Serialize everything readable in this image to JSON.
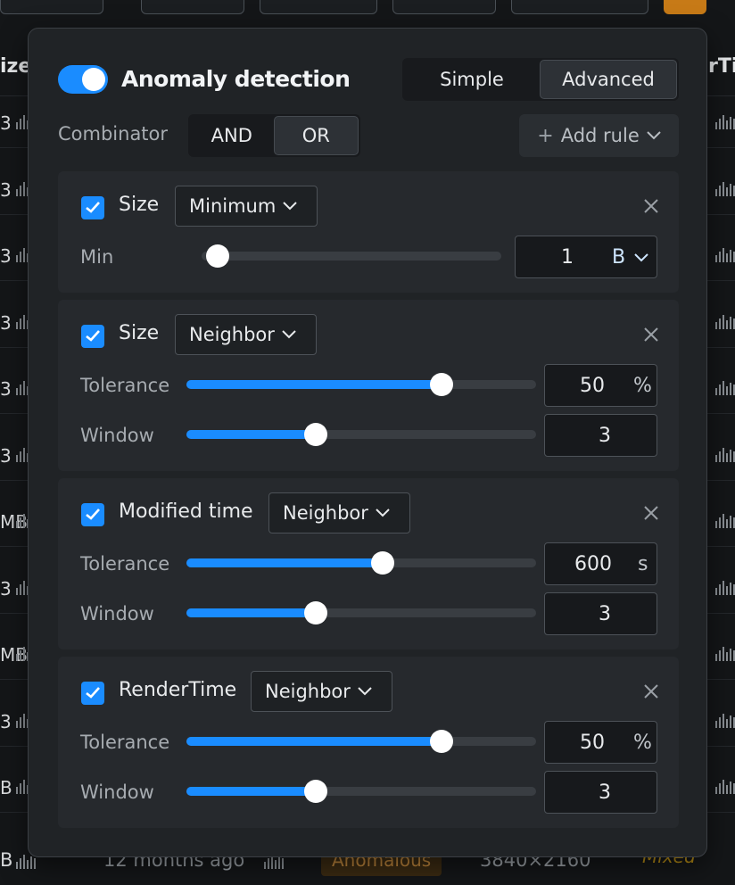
{
  "background": {
    "header_size": "ize",
    "header_render": "rTin",
    "row_left_labels": [
      "3",
      "3",
      "3",
      "3",
      "3",
      "3",
      "MB",
      "3",
      "MB",
      "3",
      "B"
    ],
    "bottom": {
      "size": "B",
      "modified": "12 months ago",
      "status": "Anomalous",
      "dimensions": "3840×2160",
      "render": "Mixed"
    }
  },
  "panel": {
    "title": "Anomaly detection",
    "enabled": true,
    "mode_options": [
      "Simple",
      "Advanced"
    ],
    "mode_selected": "Advanced",
    "combinator_label": "Combinator",
    "combinator_options": [
      "AND",
      "OR"
    ],
    "combinator_selected": "OR",
    "add_rule_label": "Add rule",
    "rules": [
      {
        "checked": true,
        "field": "Size",
        "mode": "Minimum",
        "params": [
          {
            "label": "Min",
            "value": "1",
            "unit": "B",
            "slider": 0.0
          }
        ]
      },
      {
        "checked": true,
        "field": "Size",
        "mode": "Neighbor",
        "params": [
          {
            "label": "Tolerance",
            "value": "50",
            "unit": "%",
            "slider": 0.73
          },
          {
            "label": "Window",
            "value": "3",
            "unit": "",
            "slider": 0.37
          }
        ]
      },
      {
        "checked": true,
        "field": "Modified time",
        "mode": "Neighbor",
        "params": [
          {
            "label": "Tolerance",
            "value": "600",
            "unit": "s",
            "slider": 0.56
          },
          {
            "label": "Window",
            "value": "3",
            "unit": "",
            "slider": 0.37
          }
        ]
      },
      {
        "checked": true,
        "field": "RenderTime",
        "mode": "Neighbor",
        "params": [
          {
            "label": "Tolerance",
            "value": "50",
            "unit": "%",
            "slider": 0.73
          },
          {
            "label": "Window",
            "value": "3",
            "unit": "",
            "slider": 0.37
          }
        ]
      }
    ]
  },
  "colors": {
    "accent": "#1a8cff",
    "panel": "#202326",
    "card": "#26292d"
  },
  "icons": {
    "check": "check-icon",
    "close": "close-icon",
    "chevron": "chevron-down-icon",
    "plus": "plus-icon"
  }
}
